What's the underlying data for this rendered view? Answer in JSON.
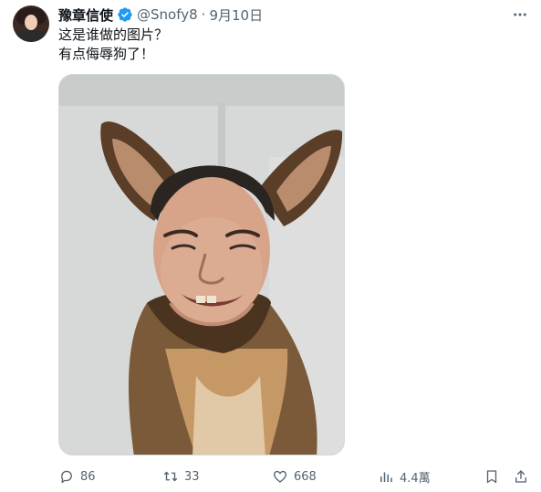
{
  "tweet": {
    "display_name": "豫章信使",
    "handle": "@Snofy8",
    "separator": "·",
    "date": "9月10日",
    "text_line1": "这是谁做的图片？",
    "text_line2": "有点侮辱狗了！",
    "image_alt": "Photo of a dog with a smiling man's face edited onto it"
  },
  "actions": {
    "replies": "86",
    "reposts": "33",
    "likes": "668",
    "views": "4.4萬"
  },
  "colors": {
    "text": "#0f1419",
    "secondary": "#536471",
    "verified": "#1d9bf0",
    "border": "#cfd9de"
  },
  "icons": [
    "more-icon",
    "verified-badge-icon",
    "reply-icon",
    "repost-icon",
    "like-icon",
    "views-icon",
    "bookmark-icon",
    "share-icon"
  ]
}
